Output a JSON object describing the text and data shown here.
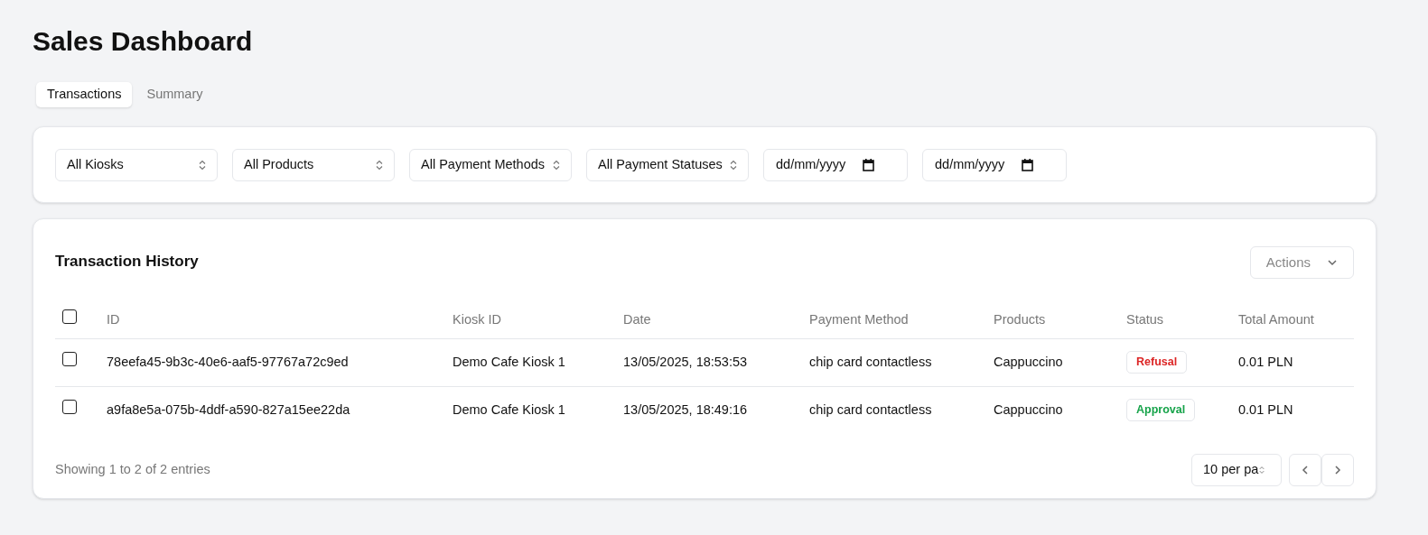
{
  "title": "Sales Dashboard",
  "tabs": [
    {
      "label": "Transactions",
      "selected": true
    },
    {
      "label": "Summary",
      "selected": false
    }
  ],
  "filters": [
    {
      "kind": "select",
      "value": "All Kiosks"
    },
    {
      "kind": "select",
      "value": "All Products"
    },
    {
      "kind": "select",
      "value": "All Payment Methods"
    },
    {
      "kind": "select",
      "value": "All Payment Statuses"
    },
    {
      "kind": "date",
      "value": "dd/mm/yyyy"
    },
    {
      "kind": "date",
      "value": "dd/mm/yyyy"
    }
  ],
  "table_card": {
    "title": "Transaction History",
    "actions_button": "Actions",
    "select_all_checked": false,
    "columns": [
      "ID",
      "Kiosk ID",
      "Date",
      "Payment Method",
      "Products",
      "Status",
      "Total Amount"
    ],
    "rows": [
      {
        "checked": false,
        "id": "78eefa45-9b3c-40e6-aaf5-97767a72c9ed",
        "kiosk_id": "Demo Cafe Kiosk 1",
        "date": "13/05/2025, 18:53:53",
        "payment_method": "chip card contactless",
        "products": "Cappuccino",
        "status": {
          "label": "Refusal",
          "color": "#dc2626"
        },
        "total_amount": "0.01 PLN"
      },
      {
        "checked": false,
        "id": "a9fa8e5a-075b-4ddf-a590-827a15ee22da",
        "kiosk_id": "Demo Cafe Kiosk 1",
        "date": "13/05/2025, 18:49:16",
        "payment_method": "chip card contactless",
        "products": "Cappuccino",
        "status": {
          "label": "Approval",
          "color": "#16a34a"
        },
        "total_amount": "0.01 PLN"
      }
    ],
    "entries_info": "Showing 1 to 2 of 2 entries",
    "page_size": "10 per pa"
  }
}
